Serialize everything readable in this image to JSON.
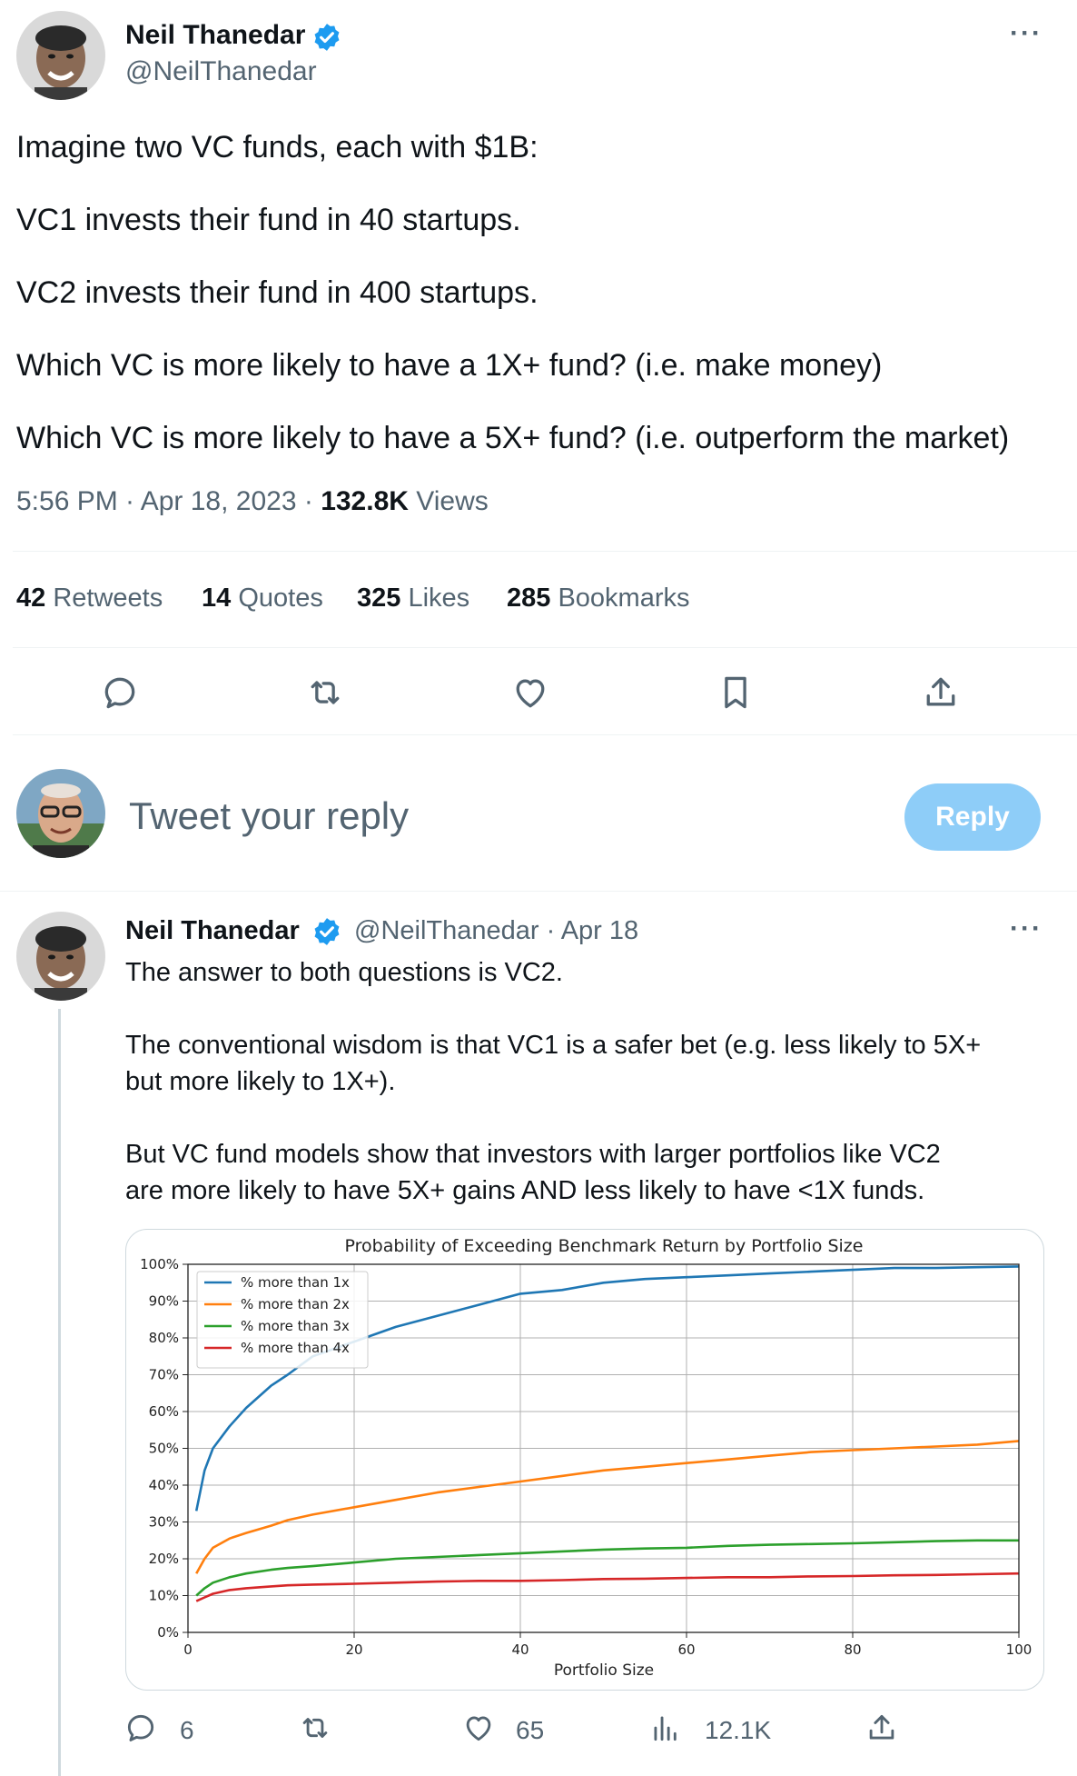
{
  "tweet": {
    "author_name": "Neil Thanedar",
    "author_handle": "@NeilThanedar",
    "lines": [
      "Imagine two VC funds, each with $1B:",
      "VC1 invests their fund in 40 startups.",
      "VC2 invests their fund in 400 startups.",
      "Which VC is more likely to have a 1X+ fund? (i.e. make money)",
      "Which VC is more likely to have a 5X+ fund? (i.e. outperform the market)"
    ],
    "time": "5:56 PM · Apr 18, 2023 · ",
    "views_count": "132.8K",
    "views_label": " Views",
    "more": "···"
  },
  "stats": {
    "retweets_count": "42",
    "retweets_label": " Retweets",
    "quotes_count": "14",
    "quotes_label": " Quotes",
    "likes_count": "325",
    "likes_label": " Likes",
    "bookmarks_count": "285",
    "bookmarks_label": " Bookmarks"
  },
  "composer": {
    "placeholder": "Tweet your reply",
    "button": "Reply"
  },
  "reply": {
    "author_name": "Neil Thanedar",
    "author_handle": "@NeilThanedar · Apr 18",
    "more": "···",
    "lines": [
      "The answer to both questions is VC2.",
      "The conventional wisdom is that VC1 is a safer bet (e.g. less likely to 5X+",
      "but more likely to 1X+).",
      "But VC fund models show that investors with larger portfolios like VC2",
      "are more likely to have 5X+ gains AND less likely to have <1X funds."
    ],
    "replies": "6",
    "likes": "65",
    "views": "12.1K"
  },
  "colors": {
    "accent": "#1d9bf0",
    "series": [
      "#1f77b4",
      "#ff7f0e",
      "#2ca02c",
      "#d62728"
    ]
  },
  "chart_data": {
    "type": "line",
    "title": "Probability of Exceeding Benchmark Return by Portfolio Size",
    "xlabel": "Portfolio Size",
    "ylabel": "",
    "xlim": [
      0,
      100
    ],
    "ylim": [
      0,
      100
    ],
    "xticks": [
      "0",
      "20",
      "40",
      "60",
      "80",
      "100"
    ],
    "yticks": [
      "0%",
      "10%",
      "20%",
      "30%",
      "40%",
      "50%",
      "60%",
      "70%",
      "80%",
      "90%",
      "100%"
    ],
    "grid": true,
    "legend": "top-left",
    "x": [
      1,
      2,
      3,
      5,
      7,
      10,
      12,
      15,
      20,
      25,
      30,
      35,
      40,
      45,
      50,
      55,
      60,
      65,
      70,
      75,
      80,
      85,
      90,
      95,
      100
    ],
    "series": [
      {
        "name": "% more than 1x",
        "values": [
          33,
          44,
          50,
          56,
          61,
          67,
          70,
          75,
          79,
          83,
          86,
          89,
          92,
          93,
          95,
          96,
          96.5,
          97,
          97.5,
          98,
          98.5,
          99,
          99,
          99.2,
          99.4
        ]
      },
      {
        "name": "% more than 2x",
        "values": [
          16,
          20,
          23,
          25.5,
          27,
          29,
          30.5,
          32,
          34,
          36,
          38,
          39.5,
          41,
          42.5,
          44,
          45,
          46,
          47,
          48,
          49,
          49.5,
          50,
          50.5,
          51,
          52
        ]
      },
      {
        "name": "% more than 3x",
        "values": [
          10,
          12,
          13.5,
          15,
          16,
          17,
          17.5,
          18,
          19,
          20,
          20.5,
          21,
          21.5,
          22,
          22.5,
          22.8,
          23,
          23.5,
          23.8,
          24,
          24.2,
          24.5,
          24.8,
          25,
          25
        ]
      },
      {
        "name": "% more than 4x",
        "values": [
          8.5,
          9.5,
          10.5,
          11.5,
          12,
          12.5,
          12.8,
          13,
          13.2,
          13.5,
          13.8,
          14,
          14,
          14.2,
          14.5,
          14.6,
          14.8,
          15,
          15,
          15.2,
          15.3,
          15.5,
          15.6,
          15.8,
          16
        ]
      }
    ]
  }
}
